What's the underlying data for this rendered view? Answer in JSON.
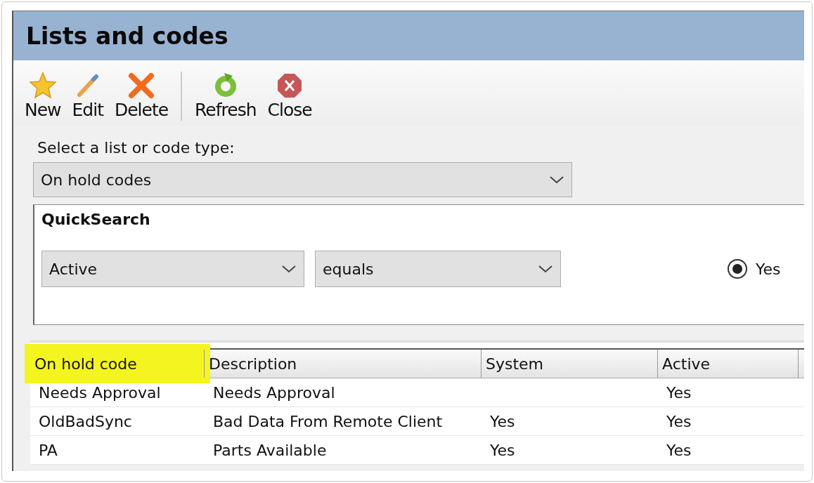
{
  "window": {
    "title": "Lists and codes"
  },
  "toolbar": [
    {
      "kind": "star",
      "label": "New"
    },
    {
      "kind": "pencil",
      "label": "Edit"
    },
    {
      "kind": "cross",
      "label": "Delete"
    },
    {
      "kind": "separator"
    },
    {
      "kind": "refresh",
      "label": "Refresh"
    },
    {
      "kind": "close",
      "label": "Close"
    }
  ],
  "list_type": {
    "label": "Select a list or code type:",
    "value": "On hold codes"
  },
  "quick_search": {
    "title": "QuickSearch",
    "field": "Active",
    "operator": "equals",
    "radio": {
      "label": "Yes",
      "selected": true
    }
  },
  "table": {
    "columns": [
      {
        "label": "On hold code",
        "highlighted": true
      },
      {
        "label": "Description",
        "highlighted": false
      },
      {
        "label": "System",
        "highlighted": false
      },
      {
        "label": "Active",
        "highlighted": false
      }
    ],
    "rows": [
      [
        "Needs Approval",
        "Needs Approval",
        "",
        "Yes"
      ],
      [
        "OldBadSync",
        "Bad Data From Remote Client",
        "Yes",
        "Yes"
      ],
      [
        "PA",
        "Parts Available",
        "Yes",
        "Yes"
      ]
    ]
  }
}
